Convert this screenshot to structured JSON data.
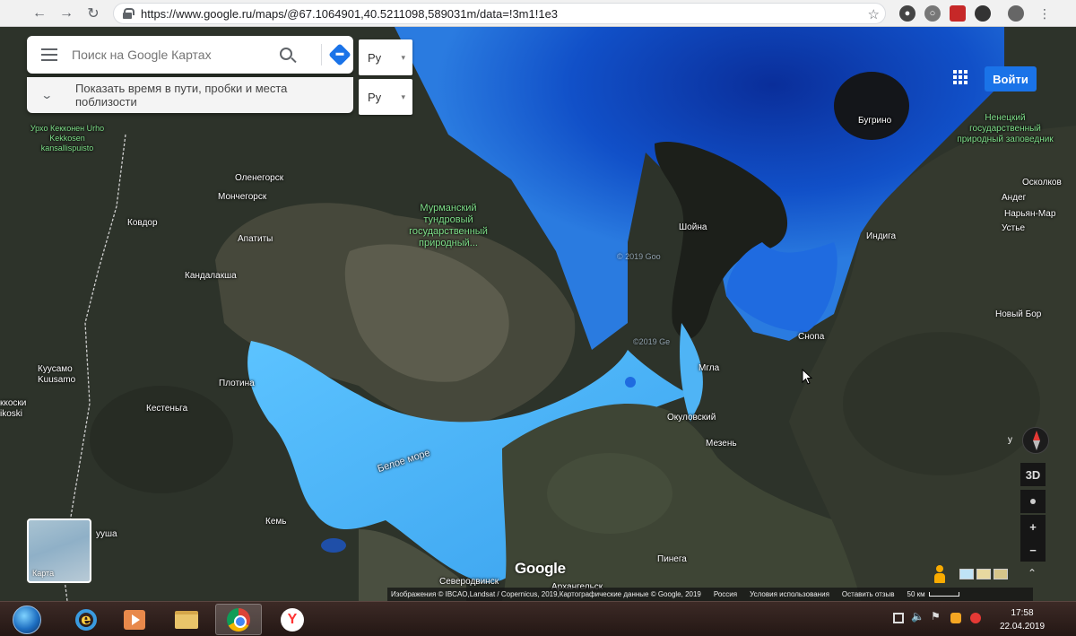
{
  "browser": {
    "url": "https://www.google.ru/maps/@67.1064901,40.5211098,589031m/data=!3m1!1e3"
  },
  "search": {
    "placeholder": "Поиск на Google Картах"
  },
  "language": {
    "selected_1": "Ру",
    "selected_2": "Ру"
  },
  "travel": {
    "text": "Показать время в пути, пробки и места поблизости"
  },
  "header": {
    "login_label": "Войти"
  },
  "map_labels": {
    "places": [
      {
        "id": "urho",
        "text": "Урхо Кекконен Urho Kekkosen kansallispuisto",
        "kind": "green"
      },
      {
        "id": "olenegorsk",
        "text": "Оленегорск"
      },
      {
        "id": "monchegorsk",
        "text": "Мончегорск"
      },
      {
        "id": "apatity",
        "text": "Апатиты"
      },
      {
        "id": "kovdor",
        "text": "Ковдор"
      },
      {
        "id": "kandalaksha",
        "text": "Кандалакша"
      },
      {
        "id": "murmansk_reserve",
        "text": "Мурманский тундровый государственный природный...",
        "kind": "green"
      },
      {
        "id": "kuusamo",
        "text": "Куусамо Kuusamo"
      },
      {
        "id": "kiski",
        "text": "ккоски ikoski"
      },
      {
        "id": "plotina",
        "text": "Плотина"
      },
      {
        "id": "kestenga",
        "text": "Кестеньга"
      },
      {
        "id": "beloe_more",
        "text": "Белое море",
        "kind": "sea"
      },
      {
        "id": "kem",
        "text": "Кемь"
      },
      {
        "id": "kuusha",
        "text": "ууша"
      },
      {
        "id": "severodvinsk",
        "text": "Северодвинск"
      },
      {
        "id": "arkhangelsk",
        "text": "Архангельск"
      },
      {
        "id": "pinega",
        "text": "Пинега"
      },
      {
        "id": "mezen",
        "text": "Мезень"
      },
      {
        "id": "okulovsky",
        "text": "Окуловский"
      },
      {
        "id": "mgla",
        "text": "Мгла"
      },
      {
        "id": "snopa",
        "text": "Снопа"
      },
      {
        "id": "shoyna",
        "text": "Шойна"
      },
      {
        "id": "indiga",
        "text": "Индига"
      },
      {
        "id": "bugrino",
        "text": "Бугрино"
      },
      {
        "id": "nenets_reserve",
        "text": "Ненецкий государственный природный заповедник",
        "kind": "green"
      },
      {
        "id": "oskolkov",
        "text": "Осколков"
      },
      {
        "id": "andeg",
        "text": "Андег"
      },
      {
        "id": "naryan_mar",
        "text": "Нарьян-Мар"
      },
      {
        "id": "ustye",
        "text": "Устье"
      },
      {
        "id": "novy_bor",
        "text": "Новый Бор"
      },
      {
        "id": "faint1",
        "text": "© 2019 Goo",
        "kind": "dim"
      },
      {
        "id": "faint2",
        "text": "©2019 Ge",
        "kind": "dim"
      }
    ]
  },
  "controls": {
    "three_d_label": "3D",
    "zoom_in_label": "+",
    "zoom_out_label": "−",
    "compass_letter": "у",
    "satellite_thumb_label": "Карта"
  },
  "footer": {
    "google_logo": "Google",
    "imagery": "Изображения © IBCAO,Landsat / Copernicus, 2019,Картографические данные © Google, 2019",
    "country": "Россия",
    "terms": "Условия использования",
    "feedback": "Оставить отзыв",
    "scale": "50 км"
  },
  "taskbar": {
    "time": "17:58",
    "date": "22.04.2019"
  },
  "colors": {
    "sea_deep": "#0b3fb5",
    "sea_shallow": "#4fb4f5",
    "land": "#3a3f32",
    "accent": "#1a73e8"
  }
}
